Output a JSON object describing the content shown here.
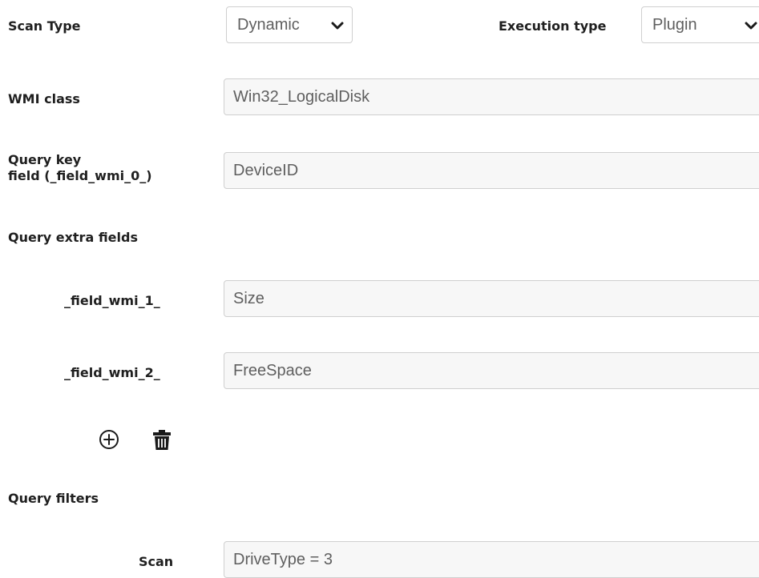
{
  "scan_type": {
    "label": "Scan Type",
    "value": "Dynamic"
  },
  "execution_type": {
    "label": "Execution type",
    "value": "Plugin"
  },
  "wmi_class": {
    "label": "WMI class",
    "value": "Win32_LogicalDisk"
  },
  "query_key": {
    "label_line1": "Query key",
    "label_line2": "field (_field_wmi_0_)",
    "value": "DeviceID"
  },
  "extra_fields": {
    "label": "Query extra fields",
    "items": [
      {
        "label": "_field_wmi_1_",
        "value": "Size"
      },
      {
        "label": "_field_wmi_2_",
        "value": "FreeSpace"
      }
    ]
  },
  "icons": {
    "add": "add-circle-icon",
    "delete": "trash-icon"
  },
  "query_filters": {
    "label": "Query filters",
    "scan_label": "Scan",
    "scan_value": "DriveType = 3"
  },
  "colors": {
    "text": "#1f1f1f",
    "field_bg": "#f7f7f7",
    "field_border": "#cfcfcf",
    "field_text": "#5f5f5f"
  }
}
